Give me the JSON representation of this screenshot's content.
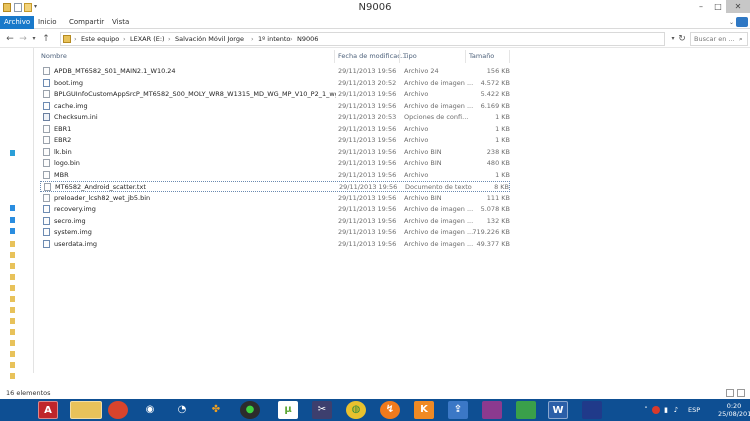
{
  "window": {
    "title": "N9006",
    "controls": [
      "minimize-icon",
      "maximize-icon",
      "close-icon"
    ]
  },
  "ribbon": {
    "tabs": [
      {
        "label": "Archivo",
        "active": true
      },
      {
        "label": "Inicio"
      },
      {
        "label": "Compartir"
      },
      {
        "label": "Vista"
      }
    ]
  },
  "address": {
    "breadcrumbs": [
      "Este equipo",
      "LEXAR (E:)",
      "Salvación Móvil Jorge",
      "1º intento",
      "N9006"
    ],
    "search_placeholder": "Buscar en ..."
  },
  "columns": {
    "name": "Nombre",
    "date": "Fecha de modificac...",
    "type": "Tipo",
    "size": "Tamaño"
  },
  "files": [
    {
      "name": "APDB_MT6582_S01_MAIN2.1_W10.24",
      "date": "29/11/2013 19:56",
      "type": "Archivo 24",
      "size": "156 KB",
      "icon": "file-icon"
    },
    {
      "name": "boot.img",
      "date": "29/11/2013 20:52",
      "type": "Archivo de imagen ...",
      "size": "4.572 KB",
      "icon": "disc-image-icon"
    },
    {
      "name": "BPLGUInfoCustomAppSrcP_MT6582_S00_MOLY_WR8_W1315_MD_WG_MP_V10_P2_1_wg_n",
      "date": "29/11/2013 19:56",
      "type": "Archivo",
      "size": "5.422 KB",
      "icon": "file-icon"
    },
    {
      "name": "cache.img",
      "date": "29/11/2013 19:56",
      "type": "Archivo de imagen ...",
      "size": "6.169 KB",
      "icon": "disc-image-icon"
    },
    {
      "name": "Checksum.ini",
      "date": "29/11/2013 20:53",
      "type": "Opciones de confi...",
      "size": "1 KB",
      "icon": "settings-file-icon"
    },
    {
      "name": "EBR1",
      "date": "29/11/2013 19:56",
      "type": "Archivo",
      "size": "1 KB",
      "icon": "file-icon"
    },
    {
      "name": "EBR2",
      "date": "29/11/2013 19:56",
      "type": "Archivo",
      "size": "1 KB",
      "icon": "file-icon"
    },
    {
      "name": "lk.bin",
      "date": "29/11/2013 19:56",
      "type": "Archivo BIN",
      "size": "238 KB",
      "icon": "file-icon"
    },
    {
      "name": "logo.bin",
      "date": "29/11/2013 19:56",
      "type": "Archivo BIN",
      "size": "480 KB",
      "icon": "file-icon"
    },
    {
      "name": "MBR",
      "date": "29/11/2013 19:56",
      "type": "Archivo",
      "size": "1 KB",
      "icon": "file-icon"
    },
    {
      "name": "MT6582_Android_scatter.txt",
      "date": "29/11/2013 19:56",
      "type": "Documento de texto",
      "size": "8 KB",
      "icon": "text-file-icon",
      "selected": true
    },
    {
      "name": "preloader_lcsh82_wet_jb5.bin",
      "date": "29/11/2013 19:56",
      "type": "Archivo BIN",
      "size": "111 KB",
      "icon": "file-icon"
    },
    {
      "name": "recovery.img",
      "date": "29/11/2013 19:56",
      "type": "Archivo de imagen ...",
      "size": "5.078 KB",
      "icon": "disc-image-icon"
    },
    {
      "name": "secro.img",
      "date": "29/11/2013 19:56",
      "type": "Archivo de imagen ...",
      "size": "132 KB",
      "icon": "disc-image-icon"
    },
    {
      "name": "system.img",
      "date": "29/11/2013 19:56",
      "type": "Archivo de imagen ...",
      "size": "719.226 KB",
      "icon": "disc-image-icon"
    },
    {
      "name": "userdata.img",
      "date": "29/11/2013 19:56",
      "type": "Archivo de imagen ...",
      "size": "49.377 KB",
      "icon": "disc-image-icon"
    }
  ],
  "status": {
    "item_count": "16 elementos"
  },
  "taskbar": {
    "apps": [
      {
        "name": "acrobat-icon",
        "active": true
      },
      {
        "name": "file-explorer-icon",
        "active": true
      },
      {
        "name": "media-player-icon"
      },
      {
        "name": "steam-icon"
      },
      {
        "name": "app-icon"
      },
      {
        "name": "app-icon"
      },
      {
        "name": "app-icon"
      },
      {
        "name": "utorrent-icon"
      },
      {
        "name": "video-editor-icon"
      },
      {
        "name": "chrome-icon"
      },
      {
        "name": "app-icon"
      },
      {
        "name": "app-icon"
      },
      {
        "name": "app-icon"
      },
      {
        "name": "archive-icon"
      },
      {
        "name": "app-icon"
      },
      {
        "name": "word-icon",
        "active": true
      },
      {
        "name": "app-icon"
      }
    ],
    "language": "ESP",
    "time": "0:20",
    "date": "25/08/2014"
  },
  "colors": {
    "accent": "#1979ca",
    "taskbar": "#0e4f93",
    "column_header": "#4c607a"
  }
}
